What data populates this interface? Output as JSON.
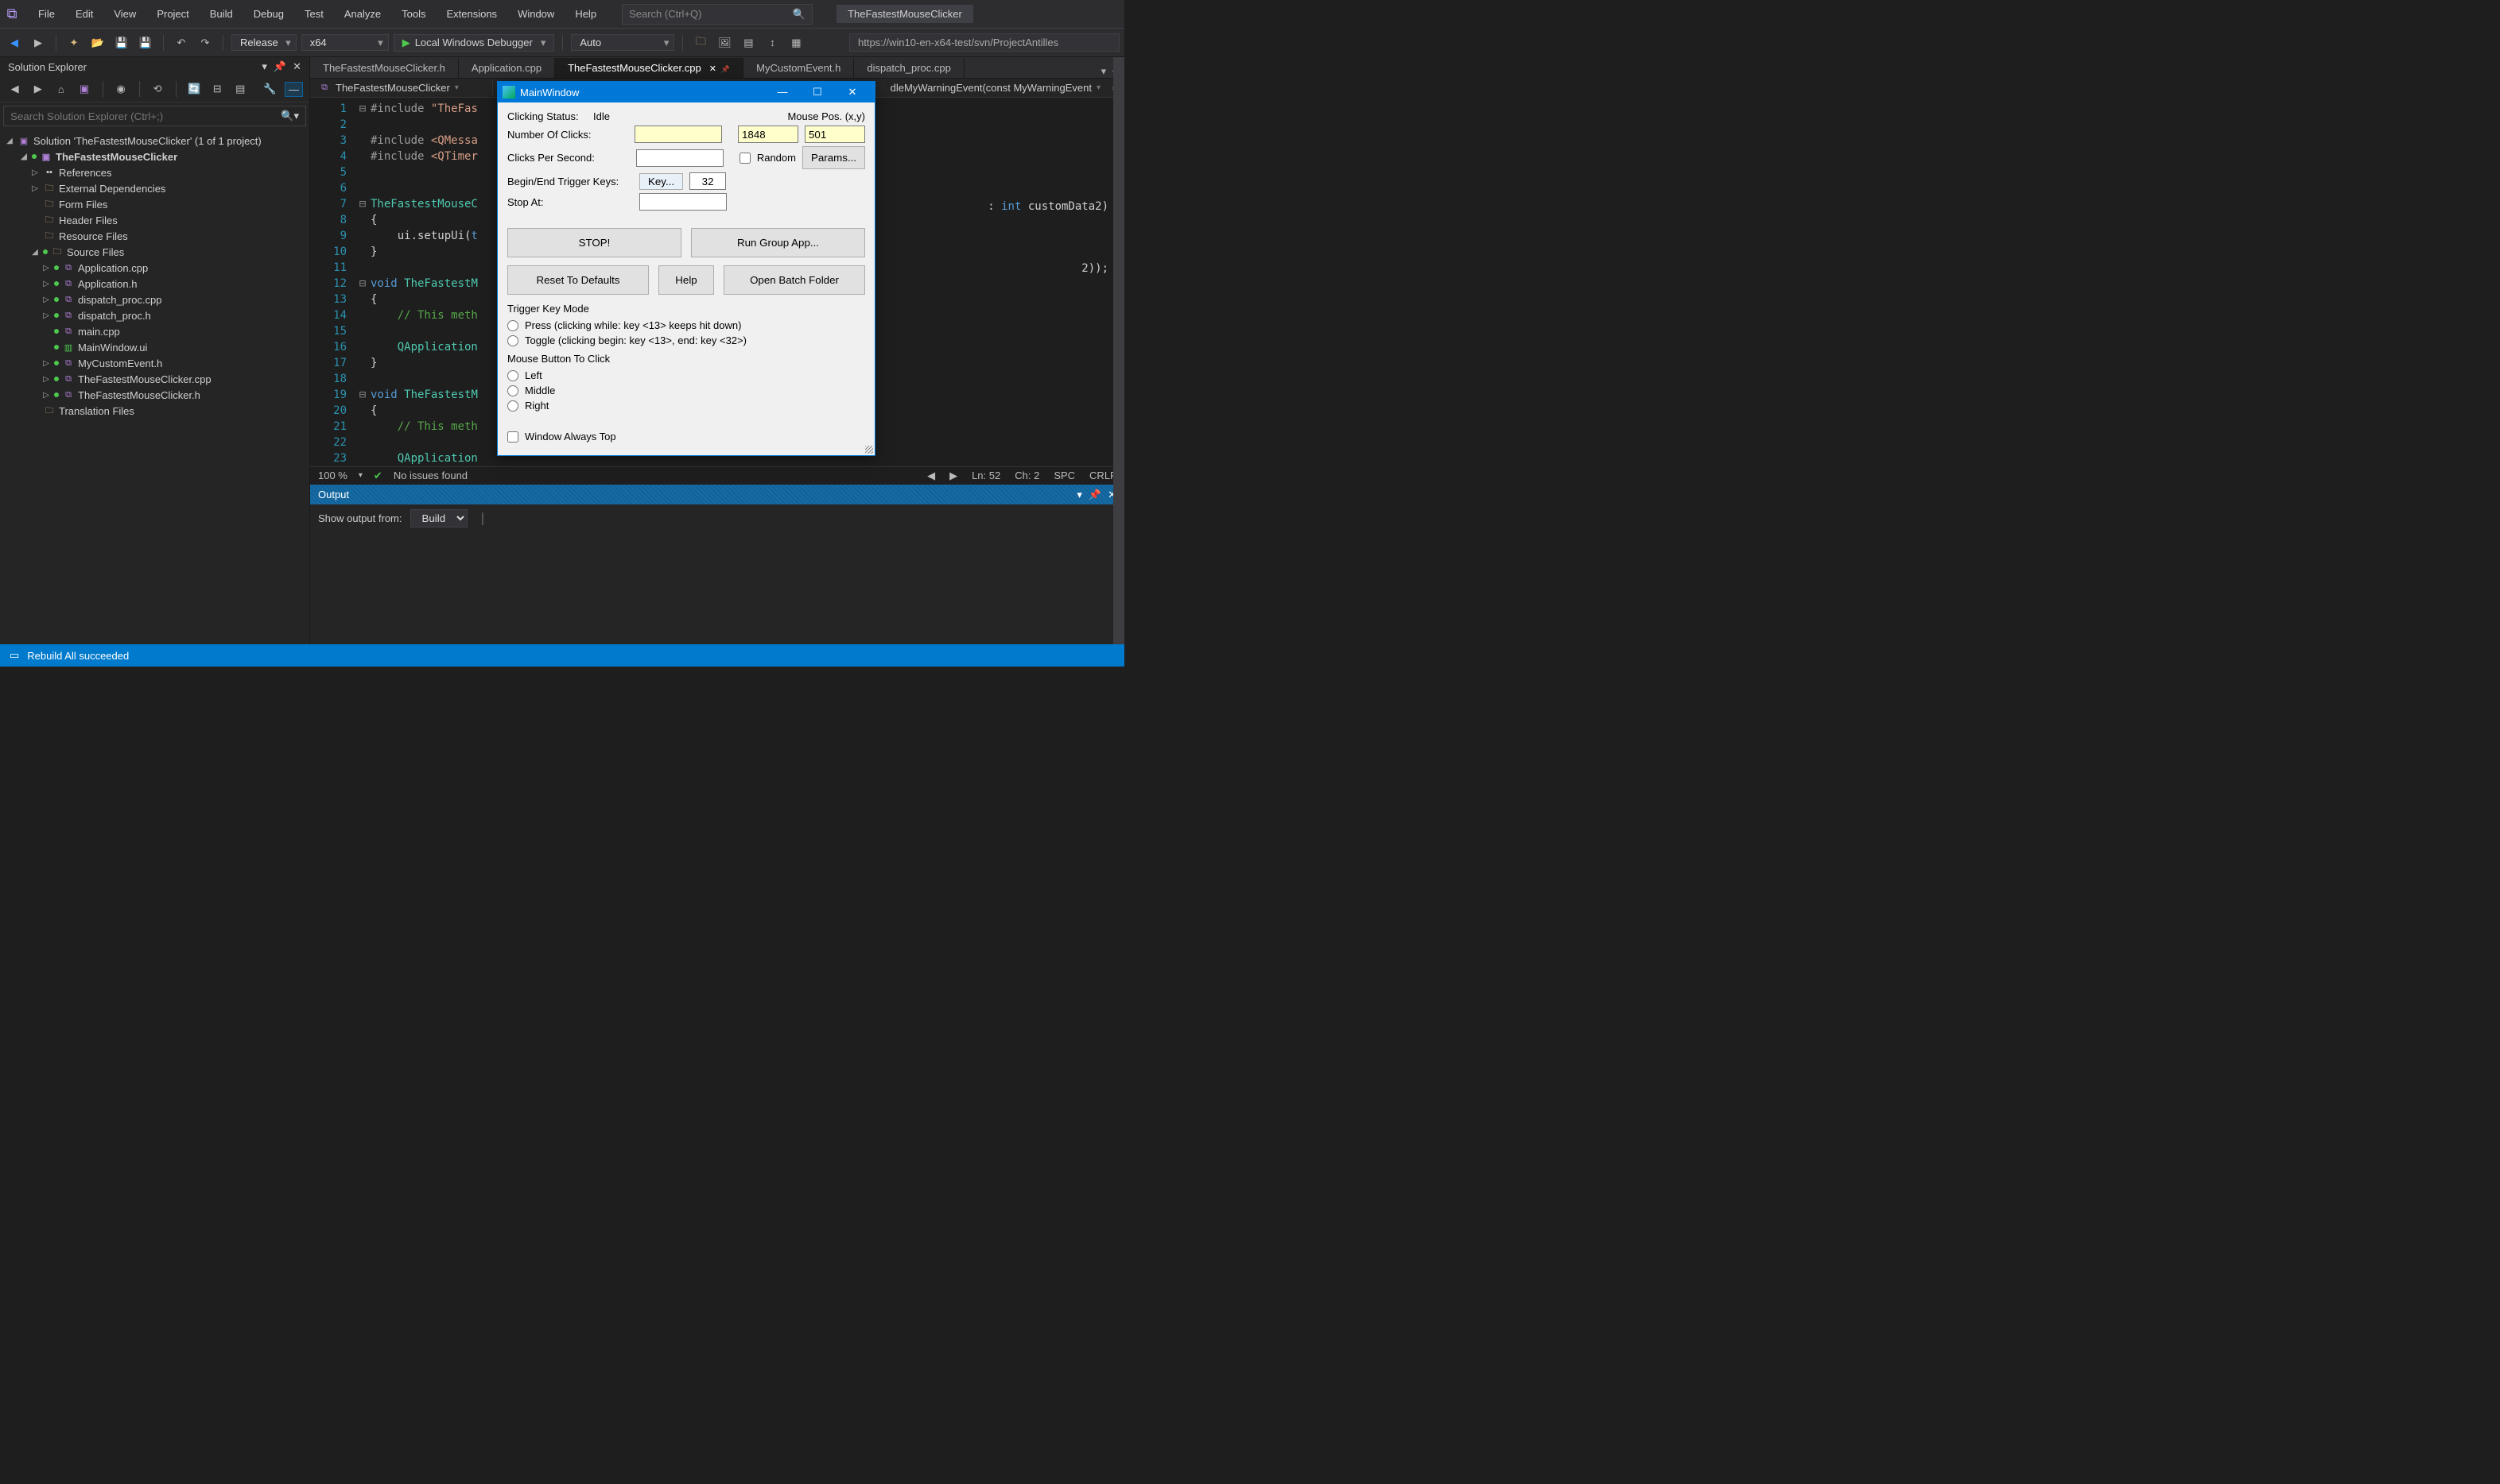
{
  "title_app": "TheFastestMouseClicker",
  "menu": [
    "File",
    "Edit",
    "View",
    "Project",
    "Build",
    "Debug",
    "Test",
    "Analyze",
    "Tools",
    "Extensions",
    "Window",
    "Help"
  ],
  "search_placeholder": "Search (Ctrl+Q)",
  "config": "Release",
  "platform": "x64",
  "debug_target": "Local Windows Debugger",
  "auto": "Auto",
  "url": "https://win10-en-x64-test/svn/ProjectAntilles",
  "solution_explorer": {
    "title": "Solution Explorer",
    "search_placeholder": "Search Solution Explorer (Ctrl+;)",
    "root": "Solution 'TheFastestMouseClicker' (1 of 1 project)",
    "project": "TheFastestMouseClicker",
    "folders": [
      "References",
      "External Dependencies",
      "Form Files",
      "Header Files",
      "Resource Files"
    ],
    "source_folder": "Source Files",
    "sources": [
      "Application.cpp",
      "Application.h",
      "dispatch_proc.cpp",
      "dispatch_proc.h",
      "main.cpp",
      "MainWindow.ui",
      "MyCustomEvent.h",
      "TheFastestMouseClicker.cpp",
      "TheFastestMouseClicker.h"
    ],
    "translation": "Translation Files"
  },
  "editor": {
    "tabs": [
      "TheFastestMouseClicker.h",
      "Application.cpp",
      "TheFastestMouseClicker.cpp",
      "MyCustomEvent.h",
      "dispatch_proc.cpp"
    ],
    "active_tab": "TheFastestMouseClicker.cpp",
    "crumb1": "TheFastestMouseClicker",
    "crumb2": "dleMyWarningEvent(const MyWarningEvent",
    "lines": [
      {
        "n": 1,
        "fold": "⊟",
        "html": "<span class='inc'>#include</span> <span class='str'>\"TheFas</span>"
      },
      {
        "n": 2,
        "fold": "",
        "html": ""
      },
      {
        "n": 3,
        "fold": "",
        "html": "<span class='inc'>#include</span> <span class='str'>&lt;QMessa</span>"
      },
      {
        "n": 4,
        "fold": "",
        "html": "<span class='inc'>#include</span> <span class='str'>&lt;QTimer</span>"
      },
      {
        "n": 5,
        "fold": "",
        "html": ""
      },
      {
        "n": 6,
        "fold": "",
        "html": ""
      },
      {
        "n": 7,
        "fold": "⊟",
        "html": "<span class='typ'>TheFastestMouseC</span>"
      },
      {
        "n": 8,
        "fold": "",
        "html": "{"
      },
      {
        "n": 9,
        "fold": "",
        "html": "    ui.setupUi(<span class='kw'>t</span>"
      },
      {
        "n": 10,
        "fold": "",
        "html": "}"
      },
      {
        "n": 11,
        "fold": "",
        "html": ""
      },
      {
        "n": 12,
        "fold": "⊟",
        "html": "<span class='kw'>void</span> <span class='typ'>TheFastestM</span>"
      },
      {
        "n": 13,
        "fold": "",
        "html": "{"
      },
      {
        "n": 14,
        "fold": "",
        "html": "    <span class='cmt'>// This meth</span>"
      },
      {
        "n": 15,
        "fold": "",
        "html": ""
      },
      {
        "n": 16,
        "fold": "",
        "html": "    <span class='typ'>QApplication</span>"
      },
      {
        "n": 17,
        "fold": "",
        "html": "}"
      },
      {
        "n": 18,
        "fold": "",
        "html": ""
      },
      {
        "n": 19,
        "fold": "⊟",
        "html": "<span class='kw'>void</span> <span class='typ'>TheFastestM</span>"
      },
      {
        "n": 20,
        "fold": "",
        "html": "{"
      },
      {
        "n": 21,
        "fold": "",
        "html": "    <span class='cmt'>// This meth</span>"
      },
      {
        "n": 22,
        "fold": "",
        "html": ""
      },
      {
        "n": 23,
        "fold": "",
        "html": "    <span class='typ'>QApplication</span>"
      }
    ],
    "rhs_frag1": ": int customData2)",
    "rhs_frag2": "2));",
    "zoom": "100 %",
    "issues": "No issues found",
    "ln": "Ln: 52",
    "ch": "Ch: 2",
    "spc": "SPC",
    "crlf": "CRLF"
  },
  "output": {
    "title": "Output",
    "show_from_label": "Show output from:",
    "show_from_value": "Build"
  },
  "status": "Rebuild All succeeded",
  "app": {
    "title": "MainWindow",
    "status_label": "Clicking Status:",
    "status_value": "Idle",
    "mouse_pos_label": "Mouse Pos. (x,y)",
    "num_clicks": "Number Of Clicks:",
    "cps": "Clicks Per Second:",
    "trigger": "Begin/End Trigger Keys:",
    "stop_at": "Stop At:",
    "key_btn": "Key...",
    "key_val": "32",
    "x": "1848",
    "y": "501",
    "random": "Random",
    "params": "Params...",
    "stop": "STOP!",
    "run_group": "Run Group App...",
    "reset": "Reset To Defaults",
    "help": "Help",
    "open_batch": "Open Batch Folder",
    "trigger_mode": "Trigger Key Mode",
    "press": "Press (clicking while: key <13> keeps hit down)",
    "toggle": "Toggle (clicking begin: key <13>, end: key <32>)",
    "mouse_btn": "Mouse Button To Click",
    "left": "Left",
    "middle": "Middle",
    "right": "Right",
    "always_top": "Window Always Top"
  }
}
